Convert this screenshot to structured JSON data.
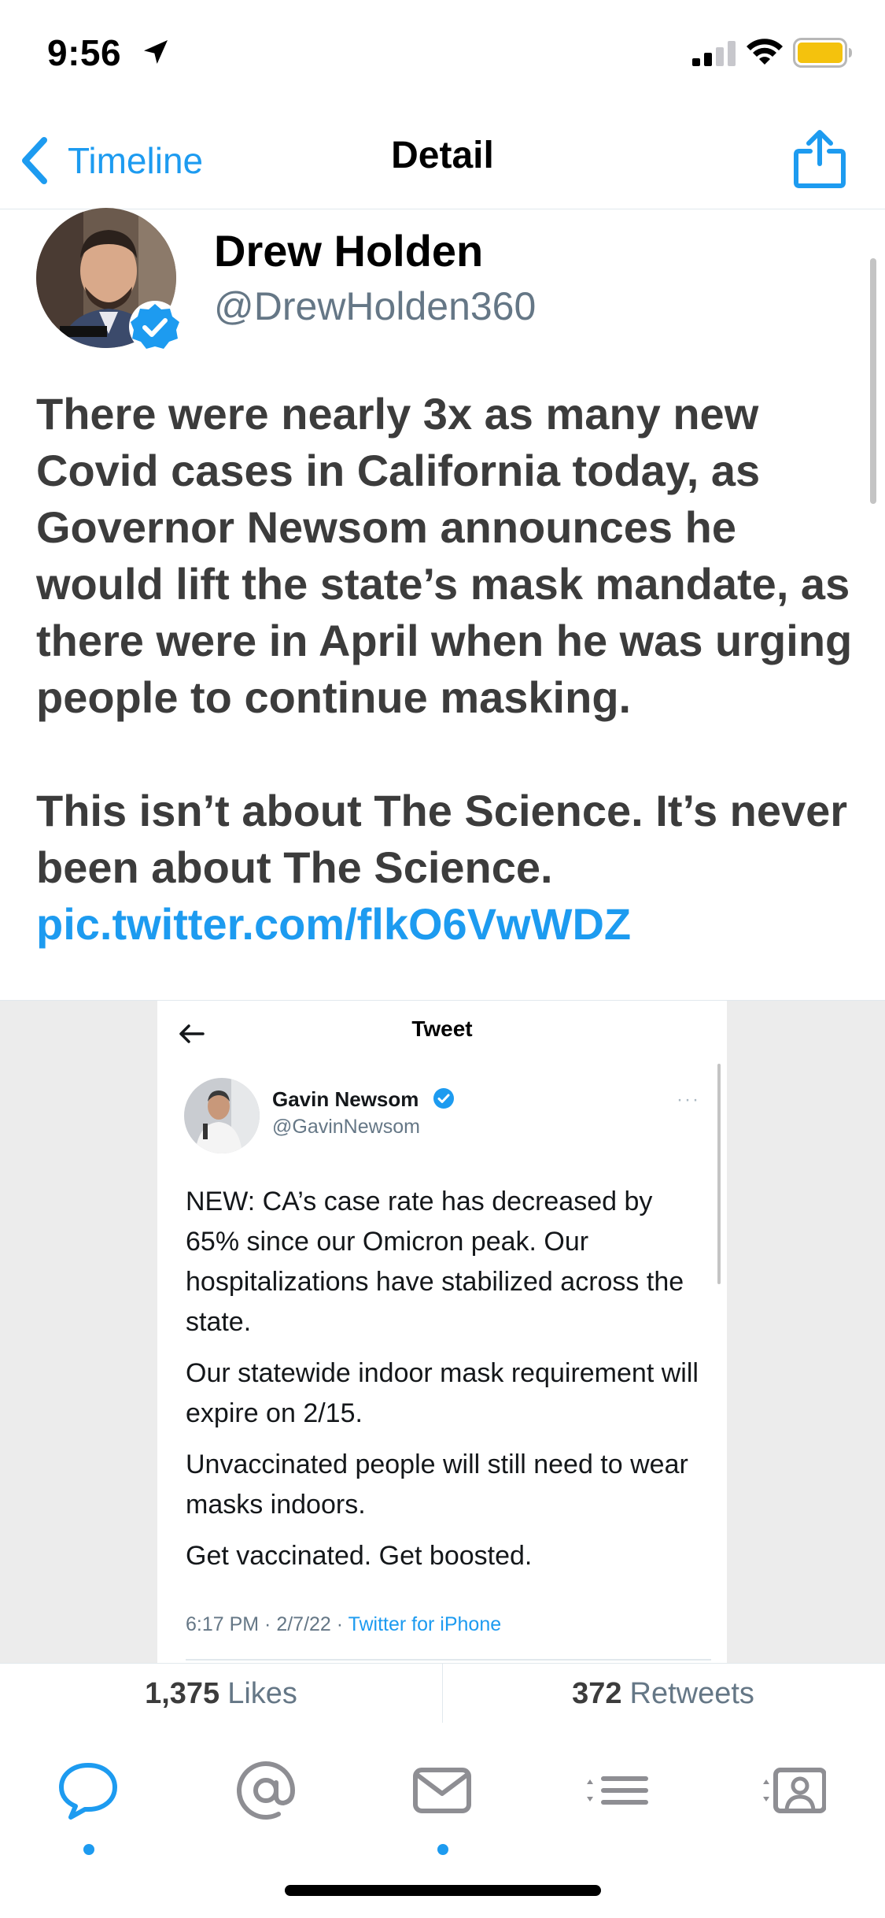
{
  "status_bar": {
    "time": "9:56"
  },
  "nav": {
    "back_label": "Timeline",
    "title": "Detail"
  },
  "tweet": {
    "display_name": "Drew Holden",
    "handle": "@DrewHolden360",
    "paragraph_1": "There were nearly 3x as many new Covid cases in California today, as Governor Newsom announces he would lift the state’s mask mandate, as there were in April when he was urging people to continue masking.",
    "paragraph_2": "This isn’t about The Science. It’s never been about The Science.",
    "link": "pic.twitter.com/flkO6VwWDZ"
  },
  "embedded": {
    "header_title": "Tweet",
    "display_name": "Gavin Newsom",
    "handle": "@GavinNewsom",
    "more": "···",
    "paragraphs": [
      "NEW: CA’s case rate has decreased by 65% since our Omicron peak. Our hospitalizations have stabilized across the state.",
      "Our statewide indoor mask requirement will expire on 2/15.",
      "Unvaccinated people will still need to wear masks indoors.",
      "Get vaccinated. Get boosted."
    ],
    "meta_time": "6:17 PM · 2/7/22 · ",
    "meta_client": "Twitter for iPhone"
  },
  "stats": {
    "likes_count": "1,375",
    "likes_label": "Likes",
    "retweets_count": "372",
    "retweets_label": "Retweets"
  },
  "tabs": [
    {
      "icon": "chat-bubble-icon",
      "active": true,
      "dot": true
    },
    {
      "icon": "mentions-icon",
      "active": false,
      "dot": false
    },
    {
      "icon": "messages-icon",
      "active": false,
      "dot": true
    },
    {
      "icon": "lists-icon",
      "active": false,
      "dot": false
    },
    {
      "icon": "profile-icon",
      "active": false,
      "dot": false
    }
  ],
  "colors": {
    "accent": "#1d9bf0",
    "tab_inactive": "#8e8e93",
    "battery": "#f4c20d"
  }
}
